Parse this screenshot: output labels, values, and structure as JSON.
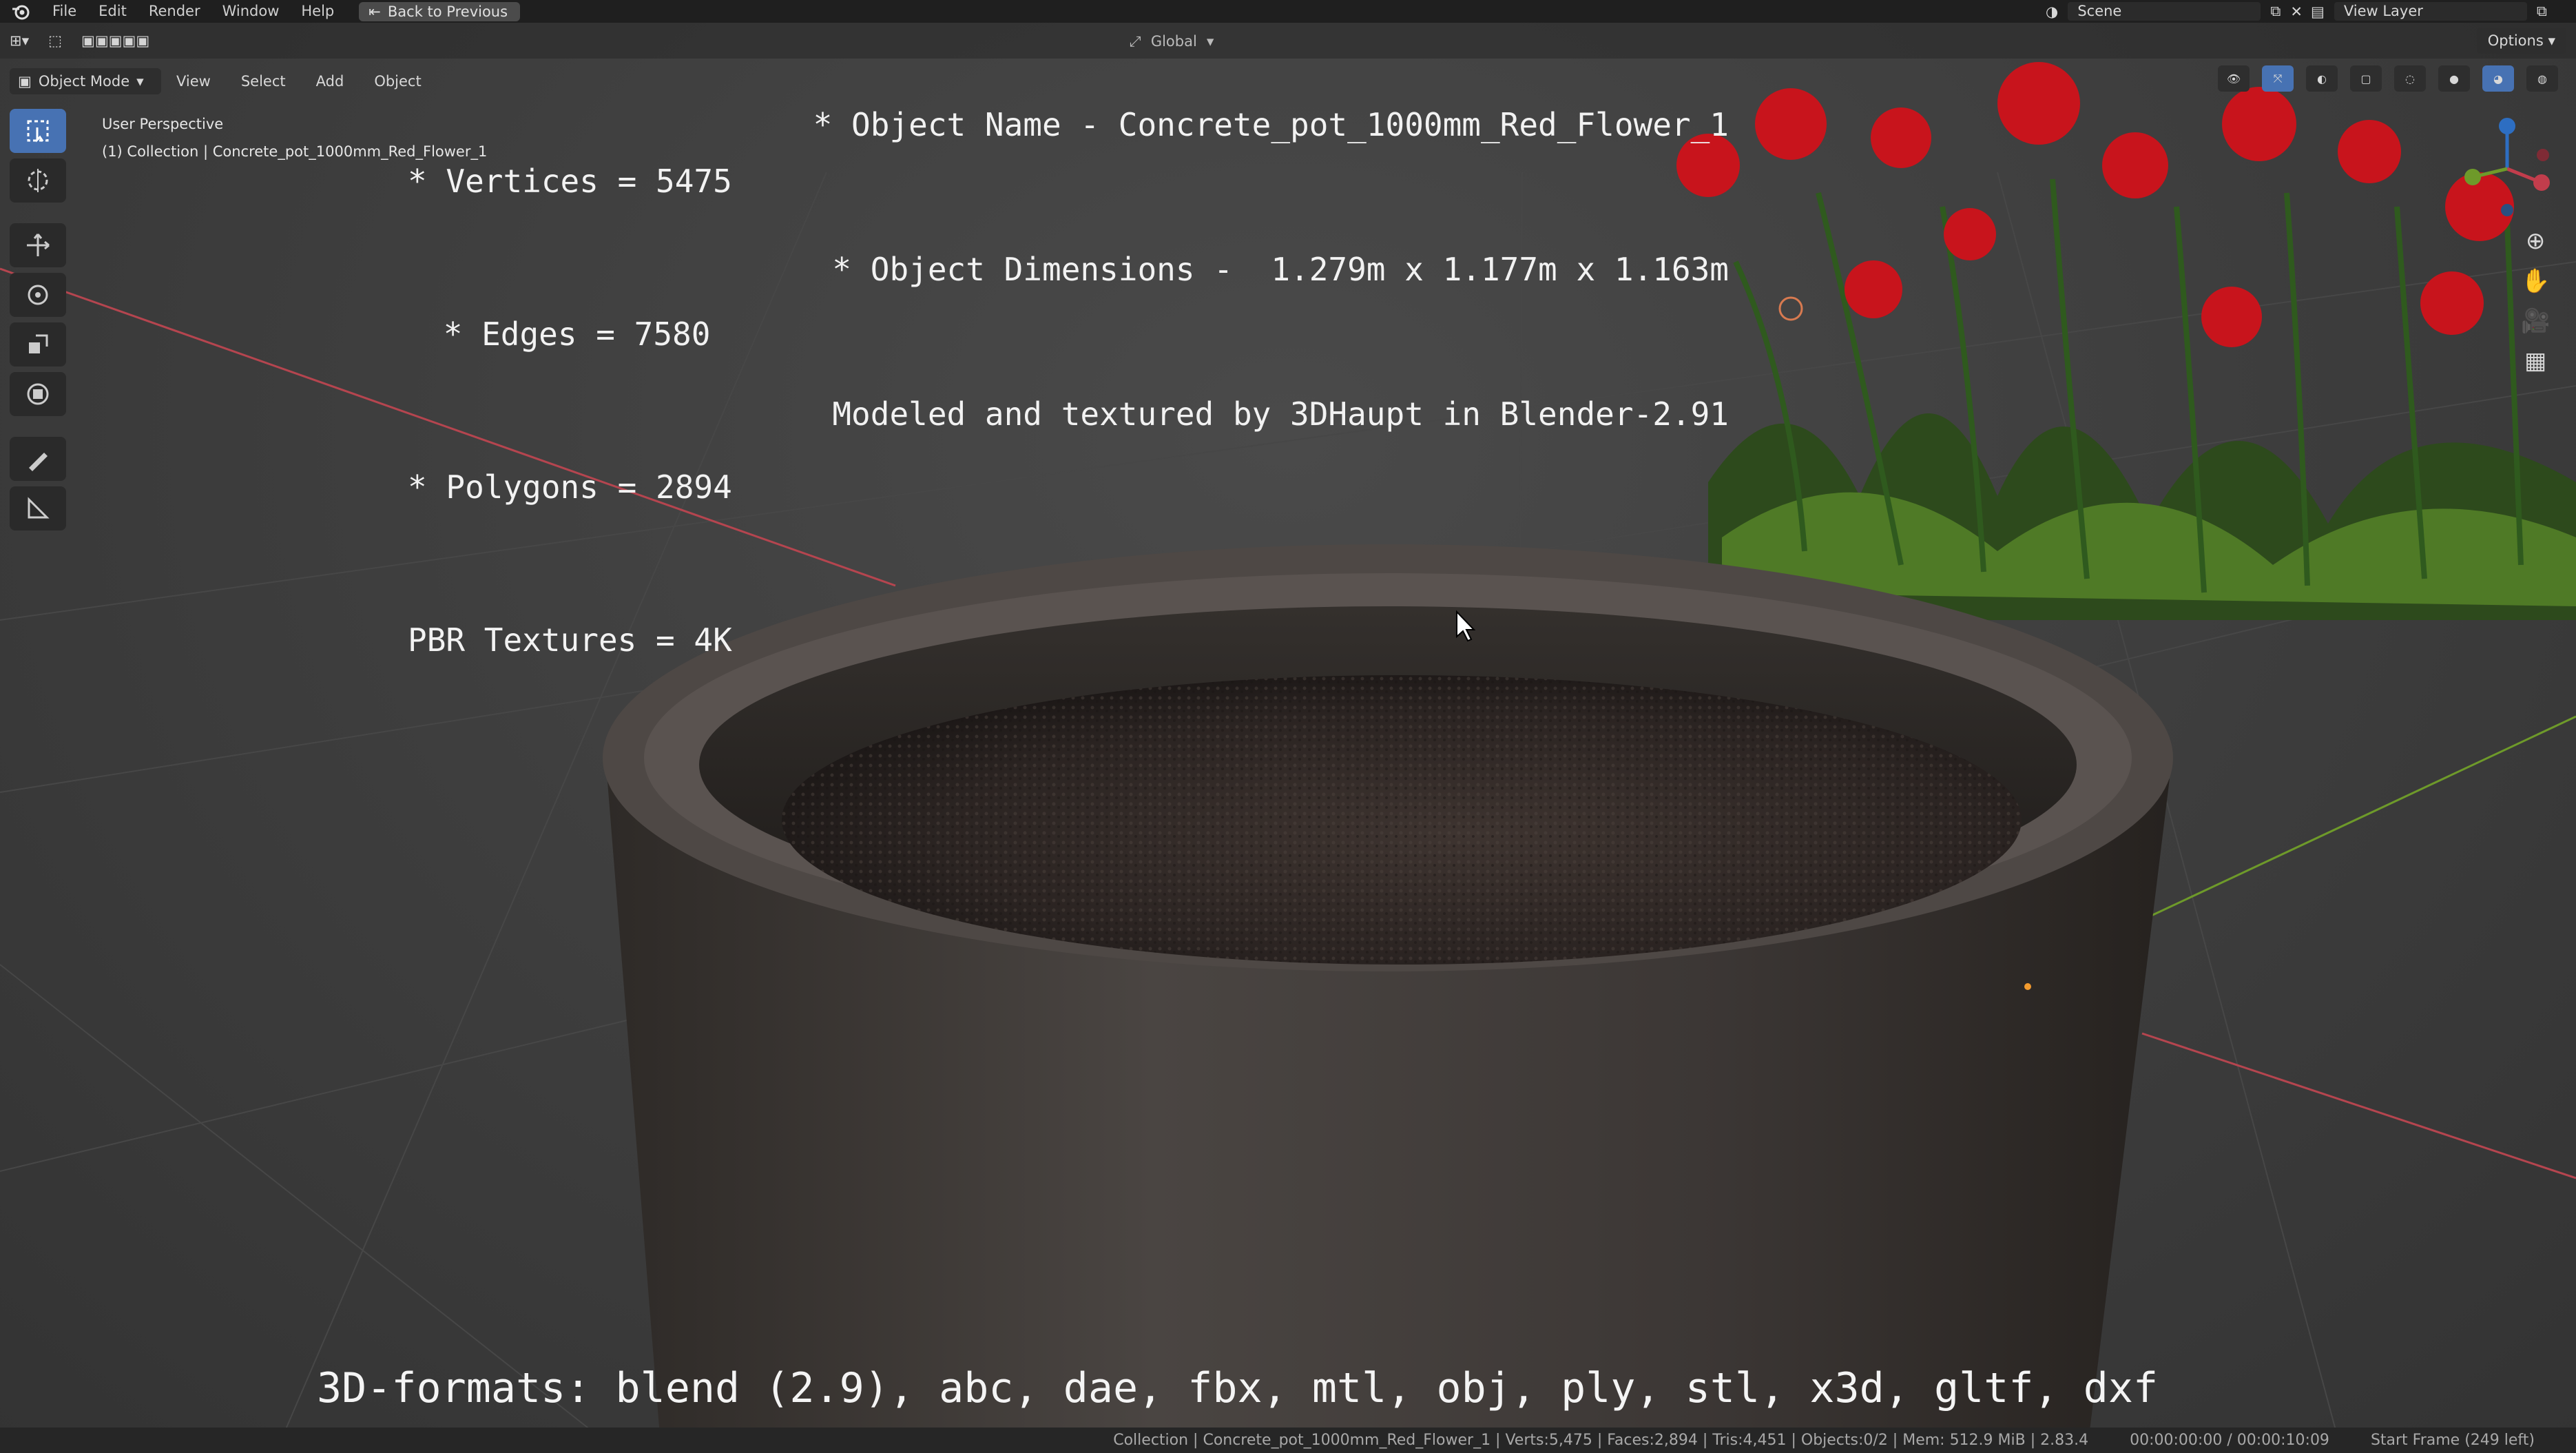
{
  "topbar": {
    "menus": [
      "File",
      "Edit",
      "Render",
      "Window",
      "Help"
    ],
    "back_label": "Back to Previous",
    "scene_label": "Scene",
    "view_layer_label": "View Layer"
  },
  "header": {
    "mode_label": "Object Mode",
    "menus": [
      "View",
      "Select",
      "Add",
      "Object"
    ],
    "transform_orientation": "Global",
    "options_label": "Options"
  },
  "viewport": {
    "perspective_label": "User Perspective",
    "collection_label": "(1) Collection | Concrete_pot_1000mm_Red_Flower_1"
  },
  "overlay": {
    "stats": [
      "* Vertices = 5475",
      " * Edges = 7580",
      "* Polygons = 2894",
      "PBR Textures = 4K"
    ],
    "object_info": [
      "* Object Name - Concrete_pot_1000mm_Red_Flower_1",
      "* Object Dimensions -  1.279m x 1.177m x 1.163m",
      "Modeled and textured by 3DHaupt in Blender-2.91"
    ],
    "formats": "3D-formats: blend (2.9), abc, dae, fbx, mtl, obj, ply, stl, x3d, gltf, dxf"
  },
  "statusbar": {
    "scene_stats": "Collection | Concrete_pot_1000mm_Red_Flower_1 | Verts:5,475 | Faces:2,894 | Tris:4,451 | Objects:0/2 | Mem: 512.9 MiB | 2.83.4",
    "time": "00:00:00:00 / 00:00:10:09",
    "frame_info": "Start Frame (249 left)"
  },
  "colors": {
    "accent": "#4772b3",
    "axis_x": "#b5454f",
    "axis_y": "#6e9a2a",
    "flower_red": "#c8141c"
  },
  "icons": {
    "left_tools": [
      "select-box-icon",
      "cursor-icon",
      "move-icon",
      "rotate-icon",
      "scale-icon",
      "transform-icon",
      "annotate-icon",
      "measure-icon"
    ],
    "right_tools": [
      "zoom-icon",
      "hand-pan-icon",
      "camera-icon",
      "grid-ortho-icon"
    ]
  }
}
